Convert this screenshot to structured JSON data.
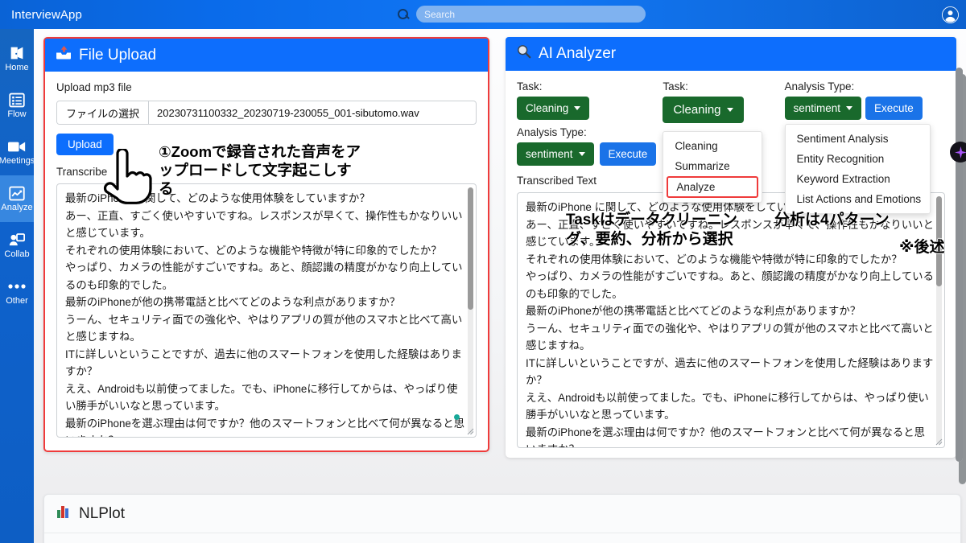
{
  "topbar": {
    "app_title": "InterviewApp",
    "search_placeholder": "Search",
    "search_value": "",
    "search_icon": "search-icon",
    "avatar_icon": "account-circle-icon"
  },
  "sidebar": {
    "items": [
      {
        "label": "Home",
        "icon": "home-door-icon",
        "active": false
      },
      {
        "label": "Flow",
        "icon": "list-card-icon",
        "active": false
      },
      {
        "label": "Meetings",
        "icon": "video-camera-icon",
        "active": false
      },
      {
        "label": "Analyze",
        "icon": "line-chart-icon",
        "active": true
      },
      {
        "label": "Collab",
        "icon": "person-share-icon",
        "active": false
      },
      {
        "label": "Other",
        "icon": "ellipsis-icon",
        "active": false
      }
    ]
  },
  "file_upload": {
    "title": "File Upload",
    "icon": "inbox-upload-icon",
    "upload_label": "Upload mp3 file",
    "choose_file_label": "ファイルの選択",
    "file_name": "20230731100332_20230719-230055_001-sibutomo.wav",
    "upload_button": "Upload",
    "transcribe_label": "Transcribe",
    "transcript_text": "最新のiPhone に関して、どのような使用体験をしていますか？\nあー、正直、すごく使いやすいですね。レスポンスが早くて、操作性もかなりいいと感じています。\nそれぞれの使用体験において、どのような機能や特徴が特に印象的でしたか？\nやっぱり、カメラの性能がすごいですね。あと、顔認識の精度がかなり向上しているのも印象的でした。\n最新のiPhoneが他の携帯電話と比べてどのような利点がありますか？\nうーん、セキュリティ面での強化や、やはりアプリの質が他のスマホと比べて高いと感じますね。\nITに詳しいということですが、過去に他のスマートフォンを使用した経験はありますか？\nええ、Androidも以前使ってました。でも、iPhoneに移行してからは、やっぱり使い勝手がいいなと思っています。\n最新のiPhoneを選ぶ理由は何ですか？他のスマートフォンと比べて何が異なると思いますか？"
  },
  "ai_analyzer": {
    "title": "AI Analyzer",
    "icon": "magnifier-icon",
    "task_label": "Task:",
    "task_value": "Cleaning",
    "analysis_type_label": "Analysis Type:",
    "analysis_type_value": "sentiment",
    "execute_button": "Execute",
    "transcribed_text_label": "Transcribed Text",
    "task_menu": [
      "Cleaning",
      "Summarize",
      "Analyze"
    ],
    "task_menu_highlighted": "Analyze",
    "analysis_menu": [
      "Sentiment Analysis",
      "Entity Recognition",
      "Keyword Extraction",
      "List Actions and Emotions"
    ],
    "transcript_text": "最新のiPhone に関して、どのような使用体験をしていますか？\nあー、正直、すごく使いやすいですね。レスポンスが早くて、操作性もかなりいいと感じています。\nそれぞれの使用体験において、どのような機能や特徴が特に印象的でしたか？\nやっぱり、カメラの性能がすごいですね。あと、顔認識の精度がかなり向上しているのも印象的でした。\n最新のiPhoneが他の携帯電話と比べてどのような利点がありますか？\nうーん、セキュリティ面での強化や、やはりアプリの質が他のスマホと比べて高いと感じますね。\nITに詳しいということですが、過去に他のスマートフォンを使用した経験はありますか？\nええ、Androidも以前使ってました。でも、iPhoneに移行してからは、やっぱり使い勝手がいいなと思っています。\n最新のiPhoneを選ぶ理由は何ですか？他のスマートフォンと比べて何が異なると思いますか？"
  },
  "nlplot": {
    "title": "NLPlot",
    "icon": "bar-chart-icon"
  },
  "annotations": {
    "upload_note": "①Zoomで録音された音声をアップロードして文字起こしする",
    "task_note": "Taskはデータクリーニング、要約、分析から選択",
    "analysis_note": "分析は4パターン",
    "analysis_note_2": "※後述",
    "cursor_icon": "pointing-hand-cursor"
  },
  "colors": {
    "brand_blue": "#0d6efd",
    "topbar_blue": "#0a6bea",
    "sidebar_blue": "#0f62cc",
    "green_button": "#19692c",
    "execute_blue": "#1a73e8",
    "highlight_red": "#ef3b3b",
    "teal_dot": "#18a999"
  }
}
